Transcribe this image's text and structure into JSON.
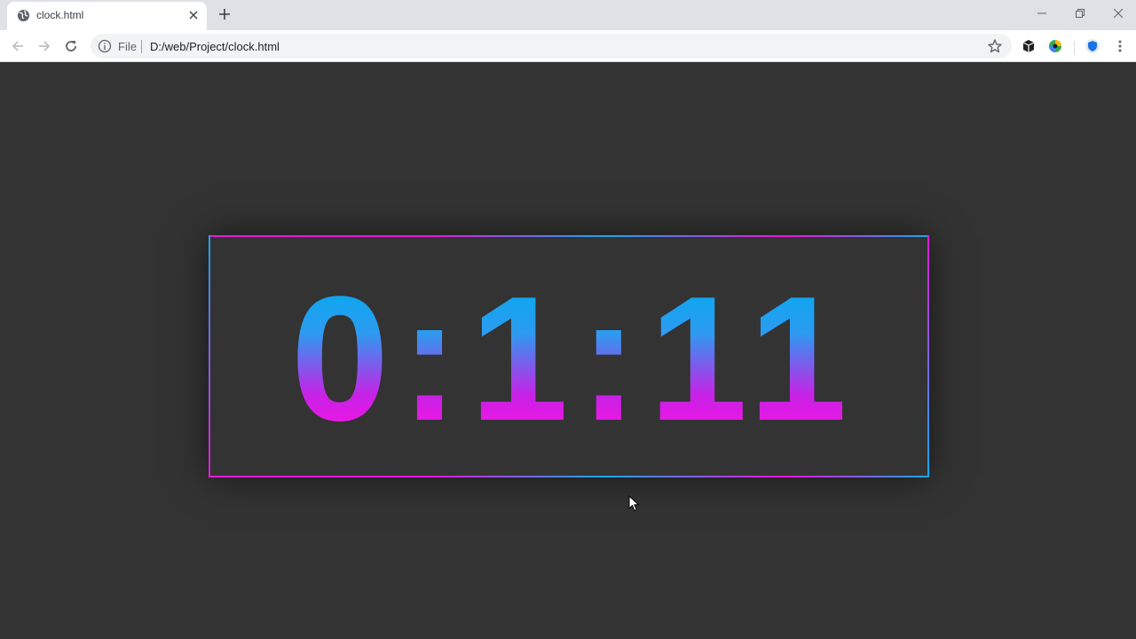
{
  "browser": {
    "tab": {
      "title": "clock.html",
      "favicon": "globe-icon"
    },
    "address": {
      "scheme_label": "File",
      "url": "D:/web/Project/clock.html"
    },
    "icons": {
      "back": "arrow-left-icon",
      "forward": "arrow-right-icon",
      "reload": "reload-icon",
      "info": "info-icon",
      "bookmark": "star-icon",
      "extensions": [
        "cube-extension-icon",
        "colorful-extension-icon",
        "shield-extension-icon"
      ],
      "menu": "kebab-menu-icon"
    }
  },
  "clock": {
    "time": "0:1:11",
    "gradient_colors": [
      "#0aa8f0",
      "#f314e4"
    ]
  }
}
